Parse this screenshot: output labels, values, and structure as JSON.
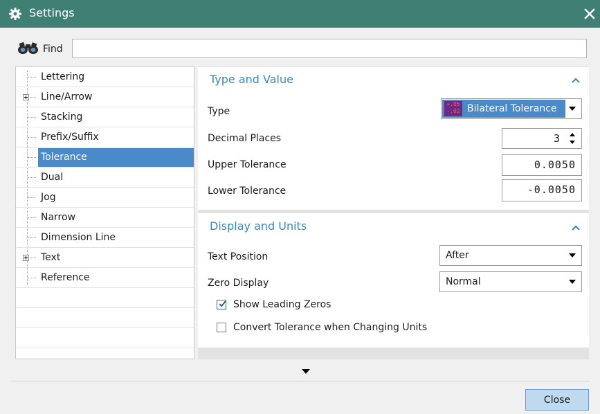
{
  "window": {
    "title": "Settings",
    "close_icon": "close-icon",
    "app_icon": "gear-icon"
  },
  "find": {
    "label": "Find",
    "value": "",
    "icon": "binoculars-icon"
  },
  "tree": {
    "items": [
      {
        "label": "Lettering",
        "expandable": false,
        "selected": false
      },
      {
        "label": "Line/Arrow",
        "expandable": true,
        "selected": false
      },
      {
        "label": "Stacking",
        "expandable": false,
        "selected": false
      },
      {
        "label": "Prefix/Suffix",
        "expandable": false,
        "selected": false
      },
      {
        "label": "Tolerance",
        "expandable": false,
        "selected": true
      },
      {
        "label": "Dual",
        "expandable": false,
        "selected": false
      },
      {
        "label": "Jog",
        "expandable": false,
        "selected": false
      },
      {
        "label": "Narrow",
        "expandable": false,
        "selected": false
      },
      {
        "label": "Dimension Line",
        "expandable": false,
        "selected": false
      },
      {
        "label": "Text",
        "expandable": true,
        "selected": false
      },
      {
        "label": "Reference",
        "expandable": false,
        "selected": false
      }
    ]
  },
  "type_value": {
    "title": "Type and Value",
    "type_label": "Type",
    "type_value": "Bilateral Tolerance",
    "type_icon_upper": "+.05",
    "type_icon_lower": "-.02",
    "decimal_label": "Decimal Places",
    "decimal_value": "3",
    "upper_label": "Upper Tolerance",
    "upper_value": "0.0050",
    "lower_label": "Lower Tolerance",
    "lower_value": "-0.0050"
  },
  "display_units": {
    "title": "Display and Units",
    "text_position_label": "Text Position",
    "text_position_value": "After",
    "zero_display_label": "Zero Display",
    "zero_display_value": "Normal",
    "show_leading_zeros_label": "Show Leading Zeros",
    "show_leading_zeros_checked": true,
    "convert_label": "Convert Tolerance when Changing Units",
    "convert_checked": false
  },
  "footer": {
    "close_label": "Close"
  },
  "colors": {
    "titlebar": "#3f7f74",
    "accent": "#3a86c3",
    "selection": "#4a8ac8",
    "button": "#bfd9ef"
  }
}
